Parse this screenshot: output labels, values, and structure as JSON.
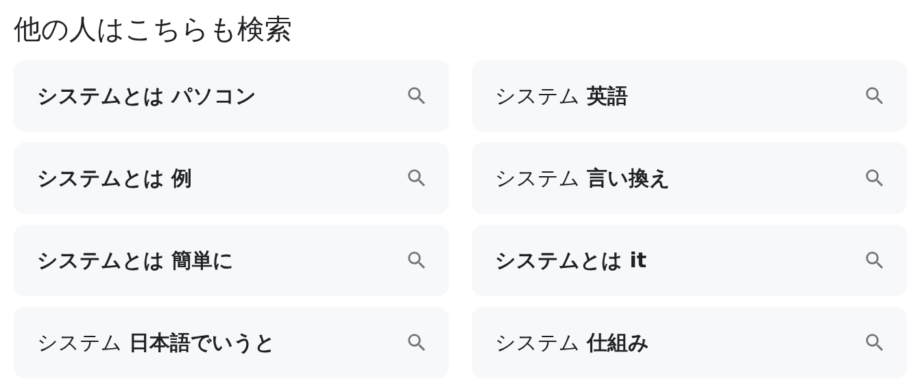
{
  "title": "他の人はこちらも検索",
  "suggestions": [
    {
      "text": "システムとは パソコン",
      "bold": true
    },
    {
      "text": "システム **英語**",
      "bold": false
    },
    {
      "text": "システムとは 例",
      "bold": true
    },
    {
      "text": "システム **言い換え**",
      "bold": false
    },
    {
      "text": "システムとは 簡単に",
      "bold": true
    },
    {
      "text": "システムとは it",
      "bold": true
    },
    {
      "text": "システム **日本語でいうと**",
      "bold": false
    },
    {
      "text": "システム **仕組み**",
      "bold": false
    }
  ]
}
